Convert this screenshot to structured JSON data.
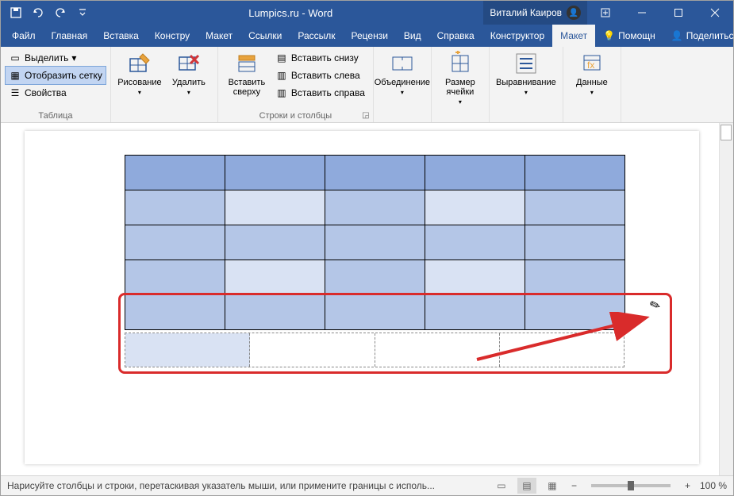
{
  "titlebar": {
    "title": "Lumpics.ru - Word",
    "user": "Виталий Каиров"
  },
  "tabs": {
    "file": "Файл",
    "home": "Главная",
    "insert": "Вставка",
    "design": "Констру",
    "layout": "Макет",
    "references": "Ссылки",
    "mailings": "Рассылк",
    "review": "Рецензи",
    "view": "Вид",
    "help": "Справка",
    "table_design": "Конструктор",
    "table_layout": "Макет",
    "tell_me": "Помощн",
    "share": "Поделиться"
  },
  "ribbon": {
    "table_group": {
      "label": "Таблица",
      "select": "Выделить",
      "gridlines": "Отобразить сетку",
      "properties": "Свойства"
    },
    "draw_group": {
      "draw": "Рисование",
      "delete": "Удалить"
    },
    "rows_cols_group": {
      "label": "Строки и столбцы",
      "insert_above": "Вставить сверху",
      "insert_below": "Вставить снизу",
      "insert_left": "Вставить слева",
      "insert_right": "Вставить справа"
    },
    "merge_group": {
      "merge": "Объединение"
    },
    "cellsize_group": {
      "cellsize": "Размер ячейки"
    },
    "align_group": {
      "align": "Выравнивание"
    },
    "data_group": {
      "data": "Данные"
    }
  },
  "status": {
    "message": "Нарисуйте столбцы и строки, перетаскивая указатель мыши, или примените границы с исполь...",
    "zoom": "100 %"
  },
  "table": {
    "rows": 5,
    "cols": 5,
    "drawn_row_cols": 4
  }
}
